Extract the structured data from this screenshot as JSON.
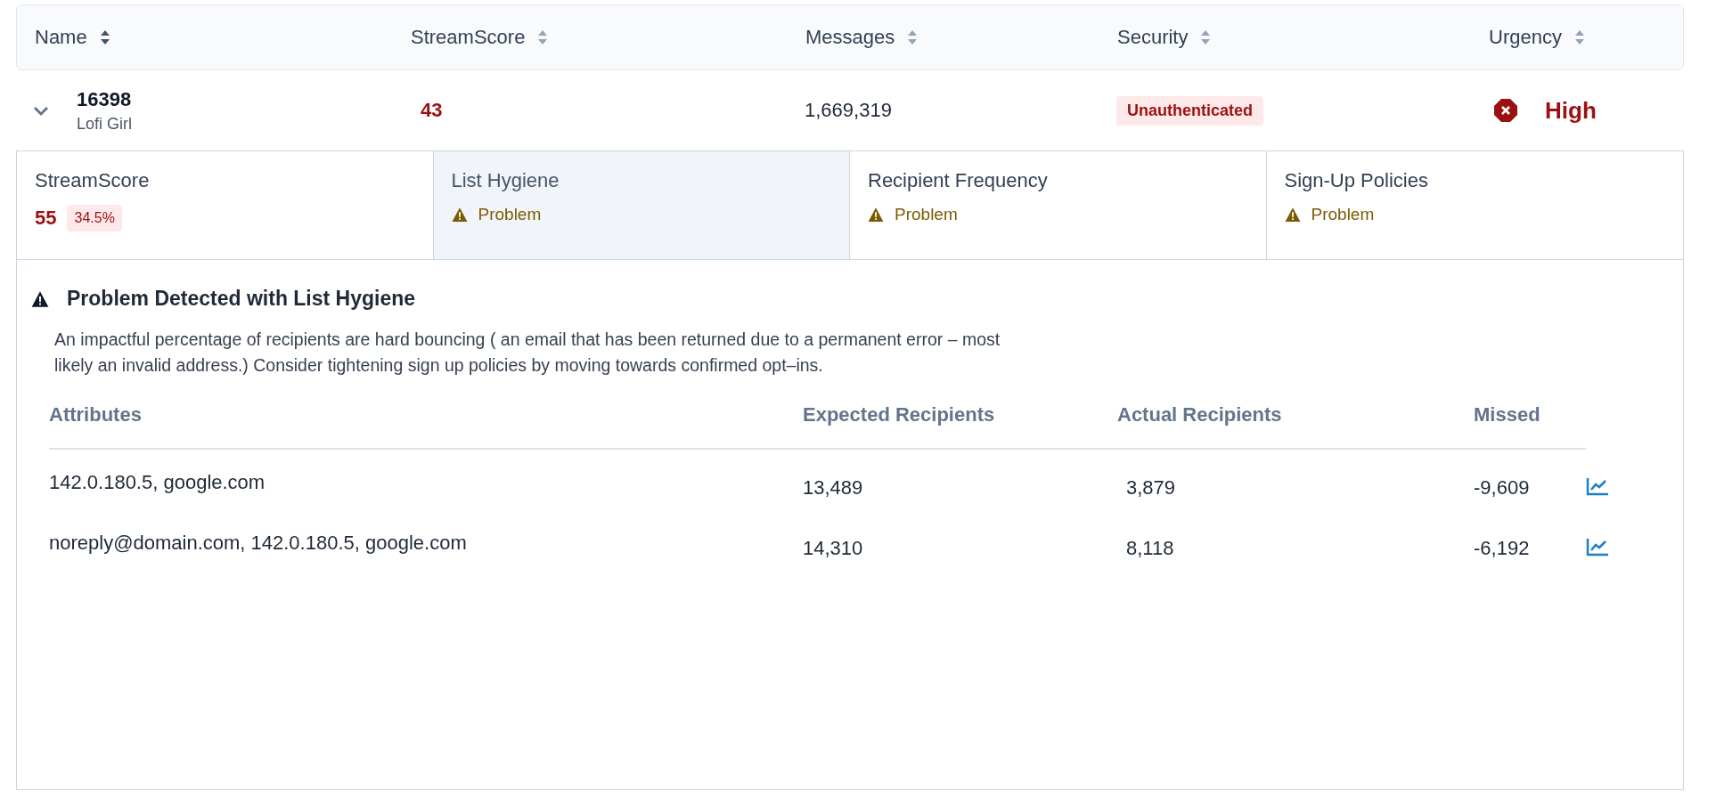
{
  "table": {
    "columns": [
      {
        "label": "Name",
        "sorted": true
      },
      {
        "label": "StreamScore",
        "sorted": false
      },
      {
        "label": "Messages",
        "sorted": false
      },
      {
        "label": "Security",
        "sorted": false
      },
      {
        "label": "Urgency",
        "sorted": false
      }
    ],
    "rows": [
      {
        "expanded": true,
        "id": "16398",
        "name": "Lofi Girl",
        "stream_score": "43",
        "messages": "1,669,319",
        "security": "Unauthenticated",
        "urgency": "High"
      }
    ]
  },
  "detail_tabs": [
    {
      "kind": "score",
      "title": "StreamScore",
      "value": "55",
      "change": "34.5%",
      "selected": false
    },
    {
      "kind": "status",
      "title": "List Hygiene",
      "status": "Problem",
      "selected": true
    },
    {
      "kind": "status",
      "title": "Recipient Frequency",
      "status": "Problem",
      "selected": false
    },
    {
      "kind": "status",
      "title": "Sign-Up Policies",
      "status": "Problem",
      "selected": false
    }
  ],
  "problem": {
    "title": "Problem Detected with List Hygiene",
    "description": "An impactful percentage of recipients are hard bouncing ( an email that has been returned due to a permanent error – most likely an invalid address.) Consider tightening sign up policies by moving towards confirmed opt–ins."
  },
  "attributes_table": {
    "columns": [
      "Attributes",
      "Expected Recipients",
      "Actual Recipients",
      "Missed"
    ],
    "rows": [
      {
        "attributes": "142.0.180.5, google.com",
        "expected": "13,489",
        "actual": "3,879",
        "missed": "-9,609"
      },
      {
        "attributes": "noreply@domain.com, 142.0.180.5, google.com",
        "expected": "14,310",
        "actual": "8,118",
        "missed": "-6,192"
      }
    ]
  }
}
